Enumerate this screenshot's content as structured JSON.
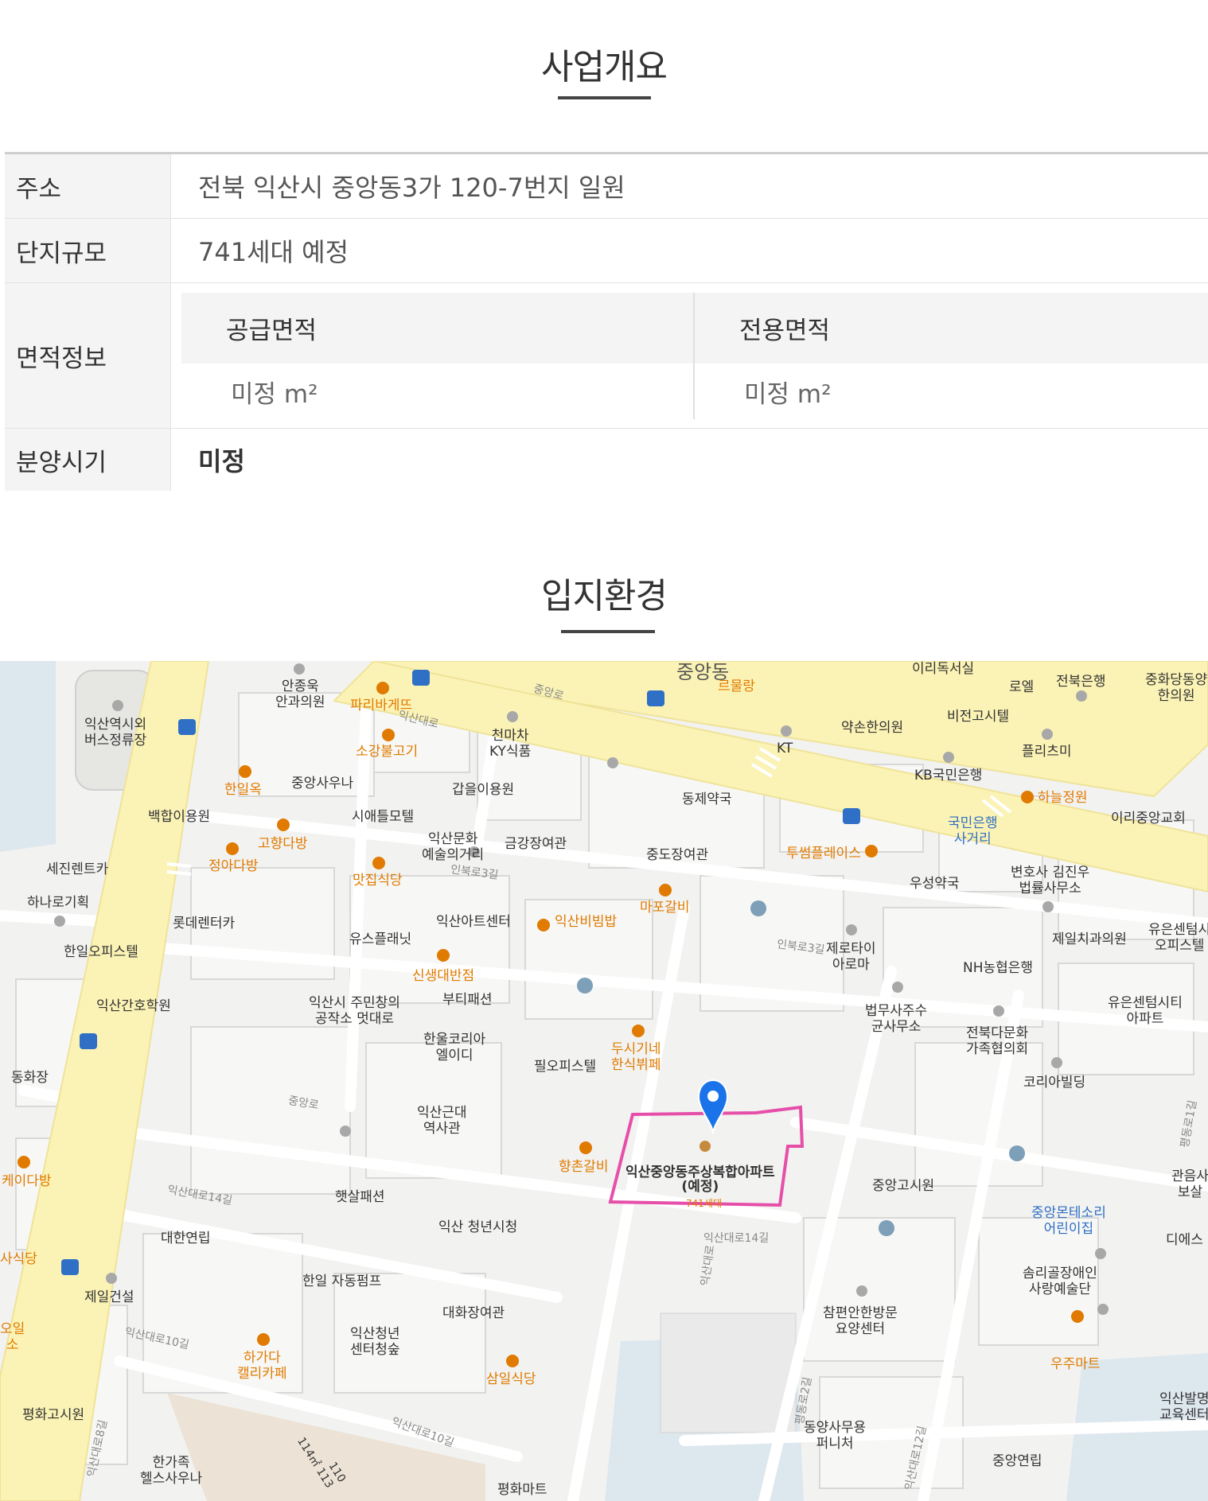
{
  "overview": {
    "title": "사업개요",
    "rows": [
      {
        "label": "주소",
        "value": "전북 익산시 중앙동3가 120-7번지 일원"
      },
      {
        "label": "단지규모",
        "value": "741세대 예정"
      },
      {
        "label": "면적정보"
      },
      {
        "label": "분양시기",
        "value": "미정"
      }
    ],
    "area": {
      "supply_label": "공급면적",
      "exclusive_label": "전용면적",
      "supply_value": "미정 m²",
      "exclusive_value": "미정 m²"
    }
  },
  "location": {
    "title": "입지환경",
    "colors": {
      "road_main": "#fbf3b5",
      "target_outline": "#e64fa9",
      "marker": "#1a73e8",
      "poi_orange": "#e07a00",
      "water": "#dde7ee"
    },
    "target": {
      "name": "익산중앙동주상복합아파트\n(예정)",
      "sub": "741세대"
    },
    "places": [
      "안종욱\n안과의원",
      "파리바게뜨",
      "익산역시외\n버스정류장",
      "소강불고기",
      "천마차\nKY식품",
      "중앙동",
      "르물랑",
      "이리독서실",
      "로엘",
      "전북은행",
      "중화당동양\n한의원",
      "약손한의원",
      "비전고시텔",
      "KT",
      "플리츠미",
      "한일옥",
      "중앙사우나",
      "갑을이용원",
      "동제약국",
      "KB국민은행",
      "하늘정원",
      "이리중앙교회",
      "백합이용원",
      "시애틀모텔",
      "국민은행\n사거리",
      "고향다방",
      "익산문화\n예술의거리",
      "금강장여관",
      "중도장여관",
      "투썸플레이스",
      "정아다방",
      "세진렌트카",
      "맛집식당",
      "우성약국",
      "변호사 김진우\n법률사무소",
      "하나로기획",
      "마포갈비",
      "롯데렌터카",
      "익산아트센터",
      "익산비빔밥",
      "제로타이\n아로마",
      "한일오피스텔",
      "유스플래닛",
      "제일치과의원",
      "유은센텀시\n오피스텔",
      "NH농협은행",
      "신생대반점",
      "익산간호학원",
      "익산시 주민창의\n공작소 멋대로",
      "부티패션",
      "법무사주수\n균사무소",
      "전북다문화\n가족협의회",
      "유은센텀시티\n아파트",
      "한울코리아\n엘이디",
      "동화장",
      "필오피스텔",
      "두시기네\n한식뷔페",
      "코리아빌딩",
      "익산근대\n역사관",
      "향촌갈비",
      "케이다방",
      "중앙고시원",
      "관음사\n보살",
      "햇살패션",
      "중앙몬테소리\n어린이집",
      "대한연립",
      "익산 청년시청",
      "디에스",
      "솜리골장애인\n사랑예술단",
      "제일건설",
      "한일 자동펌프",
      "대화장여관",
      "참편안한방문\n요양센터",
      "하가다\n캘리카페",
      "익산청년\n센터청숲",
      "삼일식당",
      "우주마트",
      "평화고시원",
      "동양사무용\n퍼니처",
      "익산발명\n교육센터",
      "한가족\n헬스사우나",
      "중앙연립",
      "평화마트",
      "사식당",
      "오일\n소"
    ],
    "roads": [
      "중앙로",
      "익산대로",
      "인북로3길",
      "인북로3길",
      "익산대로14길",
      "익산대로10길",
      "익산대로10길",
      "중앙로",
      "익산대로8길",
      "평동로2길",
      "익산대로12길",
      "평동로1길",
      "익산대로14길",
      "익산대로"
    ],
    "parcel_numbers": [
      "114㎡ 113",
      "110"
    ]
  }
}
